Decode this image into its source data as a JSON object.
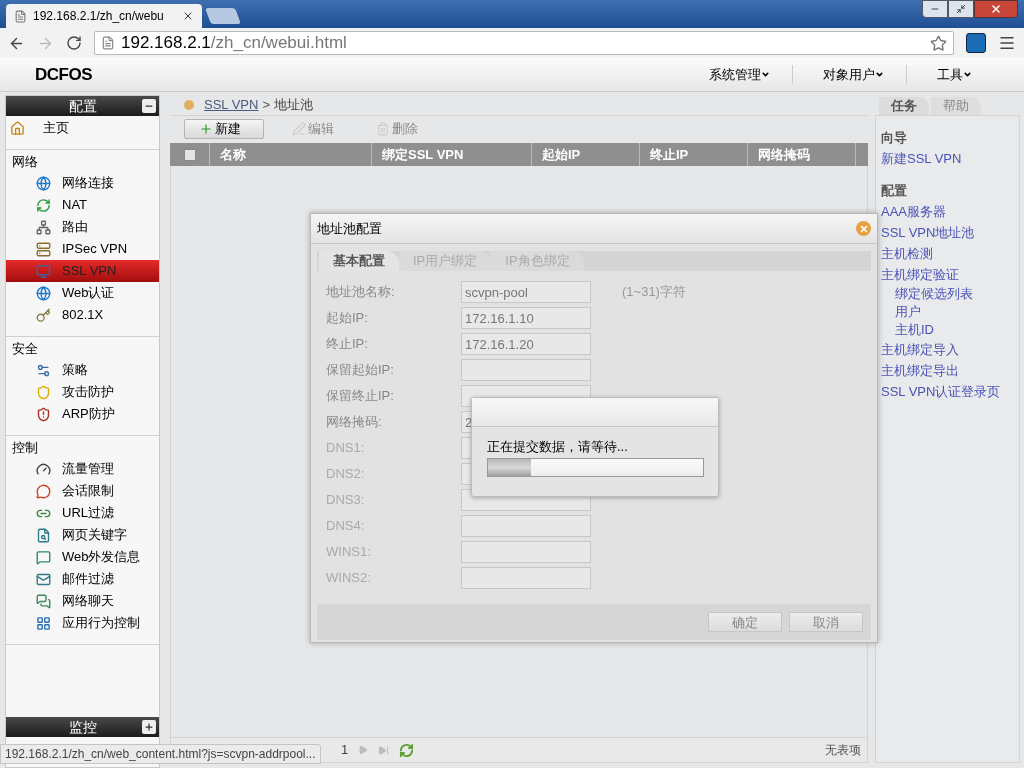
{
  "browser": {
    "tab_title": "192.168.2.1/zh_cn/webu",
    "url_host": "192.168.2.1",
    "url_path": "/zh_cn/webui.html"
  },
  "app": {
    "logo": "DCFOS",
    "menus": [
      "系统管理",
      "对象用户",
      "工具"
    ]
  },
  "sidebar": {
    "title": "配置",
    "footer_title": "监控",
    "sections": [
      {
        "items": [
          {
            "label": "主页",
            "selected": false
          }
        ]
      },
      {
        "title": "网络",
        "items": [
          {
            "label": "网络连接",
            "selected": false
          },
          {
            "label": "NAT",
            "selected": false
          },
          {
            "label": "路由",
            "selected": false
          },
          {
            "label": "IPSec VPN",
            "selected": false
          },
          {
            "label": "SSL VPN",
            "selected": true
          },
          {
            "label": "Web认证",
            "selected": false
          },
          {
            "label": "802.1X",
            "selected": false
          }
        ]
      },
      {
        "title": "安全",
        "items": [
          {
            "label": "策略",
            "selected": false
          },
          {
            "label": "攻击防护",
            "selected": false
          },
          {
            "label": "ARP防护",
            "selected": false
          }
        ]
      },
      {
        "title": "控制",
        "items": [
          {
            "label": "流量管理",
            "selected": false
          },
          {
            "label": "会话限制",
            "selected": false
          },
          {
            "label": "URL过滤",
            "selected": false
          },
          {
            "label": "网页关键字",
            "selected": false
          },
          {
            "label": "Web外发信息",
            "selected": false
          },
          {
            "label": "邮件过滤",
            "selected": false
          },
          {
            "label": "网络聊天",
            "selected": false
          },
          {
            "label": "应用行为控制",
            "selected": false
          }
        ]
      }
    ]
  },
  "main": {
    "breadcrumb": {
      "link": "SSL VPN",
      "separator": ">",
      "current": "地址池"
    },
    "toolbar": [
      {
        "label": "新建",
        "disabled": false
      },
      {
        "label": "编辑",
        "disabled": true
      },
      {
        "label": "删除",
        "disabled": true
      }
    ],
    "table": {
      "select_all_checked": false,
      "columns": [
        "名称",
        "绑定SSL VPN",
        "起始IP",
        "终止IP",
        "网络掩码"
      ]
    },
    "pager": {
      "page": "1",
      "status": "无表项"
    }
  },
  "tasks": {
    "tabs": [
      {
        "label": "任务",
        "selected": true
      },
      {
        "label": "帮助",
        "selected": false
      }
    ],
    "groups": [
      {
        "title": "向导",
        "links": [
          {
            "label": "新建SSL VPN"
          }
        ]
      },
      {
        "title": "配置",
        "links": [
          {
            "label": "AAA服务器"
          },
          {
            "label": "SSL VPN地址池"
          },
          {
            "label": "主机检测"
          },
          {
            "label": "主机绑定验证",
            "children": [
              {
                "label": "绑定候选列表"
              },
              {
                "label": "用户"
              },
              {
                "label": "主机ID"
              }
            ]
          },
          {
            "label": "主机绑定导入"
          },
          {
            "label": "主机绑定导出"
          },
          {
            "label": "SSL VPN认证登录页"
          }
        ]
      }
    ]
  },
  "dialog": {
    "title": "地址池配置",
    "tabs": [
      {
        "label": "基本配置",
        "selected": true
      },
      {
        "label": "IP用户绑定",
        "selected": false
      },
      {
        "label": "IP角色绑定",
        "selected": false
      }
    ],
    "fields": [
      {
        "label": "地址池名称:",
        "value": "scvpn-pool",
        "hint": "(1~31)字符"
      },
      {
        "label": "起始IP:",
        "value": "172.16.1.10"
      },
      {
        "label": "终止IP:",
        "value": "172.16.1.20"
      },
      {
        "label": "保留起始IP:"
      },
      {
        "label": "保留终止IP:"
      },
      {
        "label": "网络掩码:",
        "value": "2"
      },
      {
        "label": "DNS1:"
      },
      {
        "label": "DNS2:"
      },
      {
        "label": "DNS3:"
      },
      {
        "label": "DNS4:"
      },
      {
        "label": "WINS1:"
      },
      {
        "label": "WINS2:"
      }
    ],
    "buttons": [
      "确定",
      "取消"
    ]
  },
  "progress": {
    "message": "正在提交数据，请等待...",
    "level": 0.2
  },
  "status_url": "192.168.2.1/zh_cn/web_content.html?js=scvpn-addrpool..."
}
